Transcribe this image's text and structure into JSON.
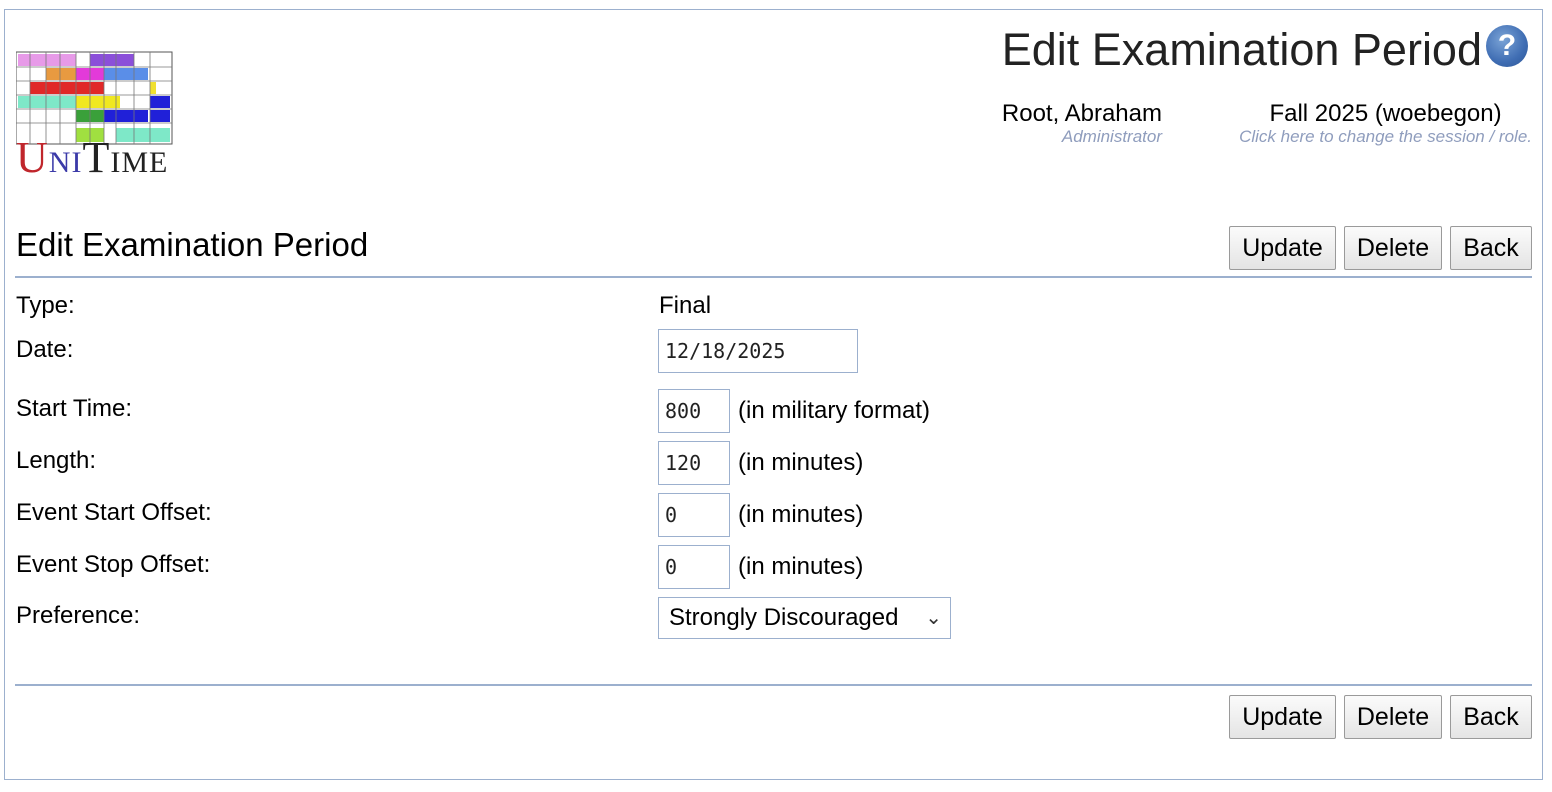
{
  "app": {
    "logo_text": "UniTime",
    "page_title": "Edit Examination Period",
    "help_icon": "question-circle-icon"
  },
  "user": {
    "name": "Root, Abraham",
    "role": "Administrator",
    "session": "Fall 2025 (woebegon)",
    "session_hint": "Click here to change the session / role."
  },
  "section": {
    "title": "Edit Examination Period"
  },
  "buttons": {
    "update": "Update",
    "delete": "Delete",
    "back": "Back"
  },
  "form": {
    "type_label": "Type:",
    "type_value": "Final",
    "date_label": "Date:",
    "date_value": "12/18/2025",
    "start_label": "Start Time:",
    "start_value": "800",
    "start_hint": "(in military format)",
    "length_label": "Length:",
    "length_value": "120",
    "length_hint": "(in minutes)",
    "event_start_label": "Event Start Offset:",
    "event_start_value": "0",
    "event_start_hint": "(in minutes)",
    "event_stop_label": "Event Stop Offset:",
    "event_stop_value": "0",
    "event_stop_hint": "(in minutes)",
    "pref_label": "Preference:",
    "pref_value": "Strongly Discouraged"
  },
  "colors": {
    "border": "#9cb0ce",
    "role_text": "#8f9dbd",
    "help_blue": "#3f6db3"
  }
}
